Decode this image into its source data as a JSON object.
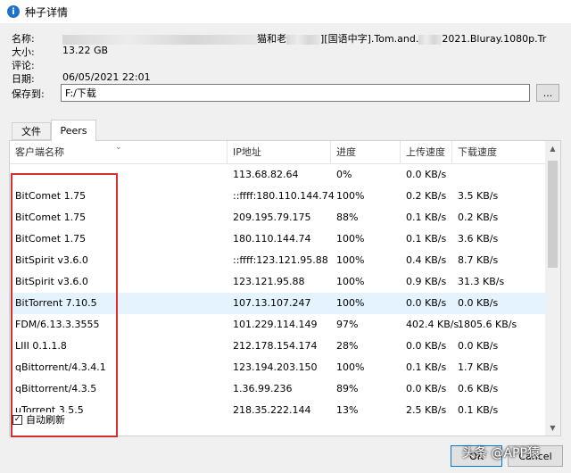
{
  "window": {
    "title": "种子详情",
    "app_icon": "i"
  },
  "info": {
    "name_label": "名称:",
    "name_mid": "猫和老",
    "name_tail": "][国语中字].Tom.and.",
    "name_end": "2021.Bluray.1080p.Tr",
    "size_label": "大小:",
    "size_value": "13.22 GB",
    "comment_label": "评论:",
    "date_label": "日期:",
    "date_value": "06/05/2021 22:01",
    "saveto_label": "保存到:",
    "saveto_value": "F:/下载",
    "browse_label": "..."
  },
  "tabs": [
    {
      "label": "文件",
      "active": false
    },
    {
      "label": "Peers",
      "active": true
    }
  ],
  "columns": [
    "客户端名称",
    "IP地址",
    "进度",
    "上传速度",
    "下载速度"
  ],
  "peers": [
    {
      "client": "",
      "ip": "113.68.82.64",
      "progress": "0%",
      "up": "0.0 KB/s",
      "down": ""
    },
    {
      "client": "BitComet 1.75",
      "ip": "::ffff:180.110.144.74",
      "progress": "100%",
      "up": "0.2 KB/s",
      "down": "3.5 KB/s"
    },
    {
      "client": "BitComet 1.75",
      "ip": "209.195.79.175",
      "progress": "88%",
      "up": "0.1 KB/s",
      "down": "0.2 KB/s"
    },
    {
      "client": "BitComet 1.75",
      "ip": "180.110.144.74",
      "progress": "100%",
      "up": "0.1 KB/s",
      "down": "3.6 KB/s"
    },
    {
      "client": "BitSpirit v3.6.0",
      "ip": "::ffff:123.121.95.88",
      "progress": "100%",
      "up": "0.4 KB/s",
      "down": "8.7 KB/s"
    },
    {
      "client": "BitSpirit v3.6.0",
      "ip": "123.121.95.88",
      "progress": "100%",
      "up": "0.9 KB/s",
      "down": "31.3 KB/s"
    },
    {
      "client": "BitTorrent 7.10.5",
      "ip": "107.13.107.247",
      "progress": "100%",
      "up": "0.0 KB/s",
      "down": "0.0 KB/s"
    },
    {
      "client": "FDM/6.13.3.3555",
      "ip": "101.229.114.149",
      "progress": "97%",
      "up": "402.4 KB/s",
      "down": "1805.6 KB/s"
    },
    {
      "client": "LIII 0.1.1.8",
      "ip": "212.178.154.174",
      "progress": "28%",
      "up": "0.0 KB/s",
      "down": "0.0 KB/s"
    },
    {
      "client": "qBittorrent/4.3.4.1",
      "ip": "123.194.203.150",
      "progress": "100%",
      "up": "0.1 KB/s",
      "down": "1.7 KB/s"
    },
    {
      "client": "qBittorrent/4.3.5",
      "ip": "1.36.99.236",
      "progress": "89%",
      "up": "0.0 KB/s",
      "down": "0.6 KB/s"
    },
    {
      "client": "µTorrent 3.5.5",
      "ip": "218.35.222.144",
      "progress": "13%",
      "up": "2.5 KB/s",
      "down": "0.1 KB/s"
    }
  ],
  "selected_row": 6,
  "auto_refresh": {
    "label": "自动刷新",
    "checked": true,
    "mark": "✓"
  },
  "buttons": {
    "ok": "OK",
    "cancel": "Cancel"
  },
  "watermark": "头条 @APP猿",
  "colors": {
    "selection": "#e5f3ff",
    "highlight_box": "#d62e2e",
    "accent": "#0078d7"
  }
}
